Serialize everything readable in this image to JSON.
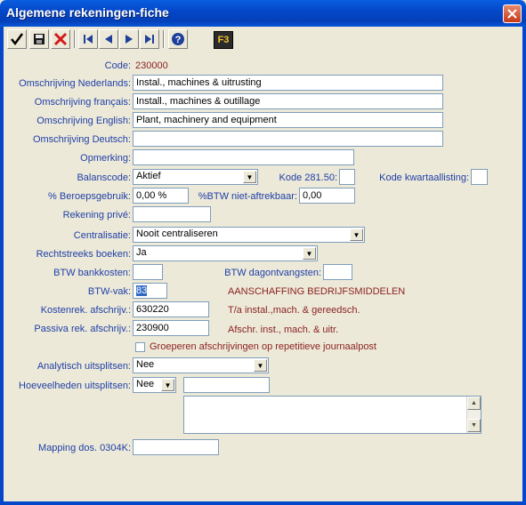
{
  "window": {
    "title": "Algemene rekeningen-fiche"
  },
  "toolbar": {
    "icons": [
      "check-icon",
      "save-icon",
      "delete-icon",
      "first-record-icon",
      "previous-record-icon",
      "next-record-icon",
      "last-record-icon",
      "help-icon"
    ],
    "f3_label": "F3"
  },
  "form": {
    "code": {
      "label": "Code:",
      "value": "230000"
    },
    "omschrijving_nl": {
      "label": "Omschrijving Nederlands:",
      "value": "Instal., machines & uitrusting"
    },
    "omschrijving_fr": {
      "label": "Omschrijving français:",
      "value": "Install., machines & outillage"
    },
    "omschrijving_en": {
      "label": "Omschrijving English:",
      "value": "Plant, machinery and equipment"
    },
    "omschrijving_de": {
      "label": "Omschrijving Deutsch:",
      "value": ""
    },
    "opmerking": {
      "label": "Opmerking:",
      "value": ""
    },
    "balanscode": {
      "label": "Balanscode:",
      "value": "Aktief"
    },
    "kode_281": {
      "label": "Kode 281.50:",
      "value": ""
    },
    "kode_kwartaal": {
      "label": "Kode kwartaallisting:",
      "value": ""
    },
    "beroepsgebruik": {
      "label": "% Beroepsgebruik:",
      "value": "0,00 %"
    },
    "btw_niet_aftrek": {
      "label": "%BTW niet-aftrekbaar:",
      "value": "0,00"
    },
    "rekening_prive": {
      "label": "Rekening privé:",
      "value": ""
    },
    "centralisatie": {
      "label": "Centralisatie:",
      "value": "Nooit centraliseren"
    },
    "rechtstreeks": {
      "label": "Rechtstreeks boeken:",
      "value": "Ja"
    },
    "btw_bankkosten": {
      "label": "BTW bankkosten:",
      "value": ""
    },
    "btw_dagontvangsten": {
      "label": "BTW dagontvangsten:",
      "value": ""
    },
    "btw_vak": {
      "label": "BTW-vak:",
      "value": "83",
      "description": "AANSCHAFFING BEDRIJFSMIDDELEN"
    },
    "kostenrek": {
      "label": "Kostenrek. afschrijv.:",
      "value": "630220",
      "description": "T/a instal.,mach. & gereedsch."
    },
    "passiva": {
      "label": "Passiva rek. afschrijv.:",
      "value": "230900",
      "description": "Afschr. inst., mach. & uitr."
    },
    "groeperen": {
      "label": "Groeperen afschrijvingen op repetitieve journaalpost",
      "checked": false
    },
    "analytisch": {
      "label": "Analytisch uitsplitsen:",
      "value": "Nee"
    },
    "hoeveelheden": {
      "label": "Hoeveelheden uitsplitsen:",
      "value": "Nee",
      "unit_value": "",
      "memo_value": ""
    },
    "mapping": {
      "label": "Mapping dos. 0304K:",
      "value": ""
    }
  }
}
